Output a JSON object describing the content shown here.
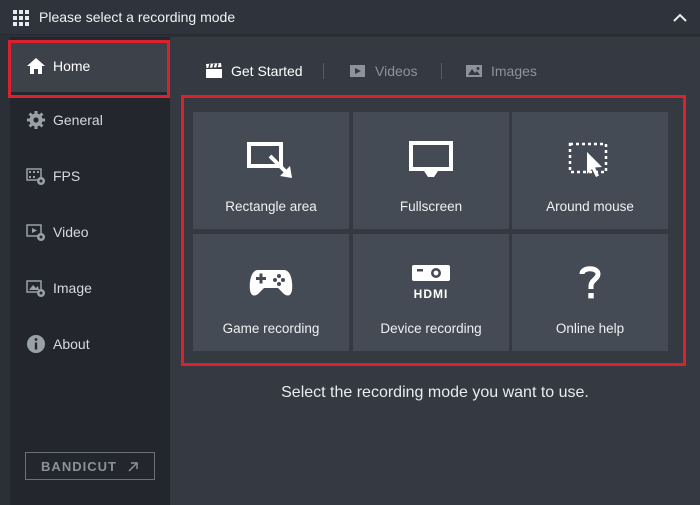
{
  "window": {
    "title": "Please select a recording mode"
  },
  "sidebar": {
    "items": [
      {
        "label": "Home",
        "icon": "home-icon"
      },
      {
        "label": "General",
        "icon": "gear-icon"
      },
      {
        "label": "FPS",
        "icon": "fps-gear-icon"
      },
      {
        "label": "Video",
        "icon": "video-gear-icon"
      },
      {
        "label": "Image",
        "icon": "image-gear-icon"
      },
      {
        "label": "About",
        "icon": "info-icon"
      }
    ],
    "active": "Home",
    "brand_label": "BANDICUT"
  },
  "tabs": [
    {
      "label": "Get Started",
      "icon": "clapperboard-icon"
    },
    {
      "label": "Videos",
      "icon": "video-play-icon"
    },
    {
      "label": "Images",
      "icon": "picture-icon"
    }
  ],
  "modes": [
    {
      "label": "Rectangle area",
      "icon": "rectangle-area-icon"
    },
    {
      "label": "Fullscreen",
      "icon": "monitor-icon"
    },
    {
      "label": "Around mouse",
      "icon": "around-mouse-icon"
    },
    {
      "label": "Game recording",
      "icon": "gamepad-icon"
    },
    {
      "label": "Device recording",
      "icon": "hdmi-device-icon"
    },
    {
      "label": "Online help",
      "icon": "question-icon"
    }
  ],
  "hint": "Select the recording mode you want to use.",
  "colors": {
    "highlight": "#d9222e",
    "sidebar_bg": "#23272d",
    "main_bg": "#343942",
    "tile_bg": "#454b55"
  }
}
